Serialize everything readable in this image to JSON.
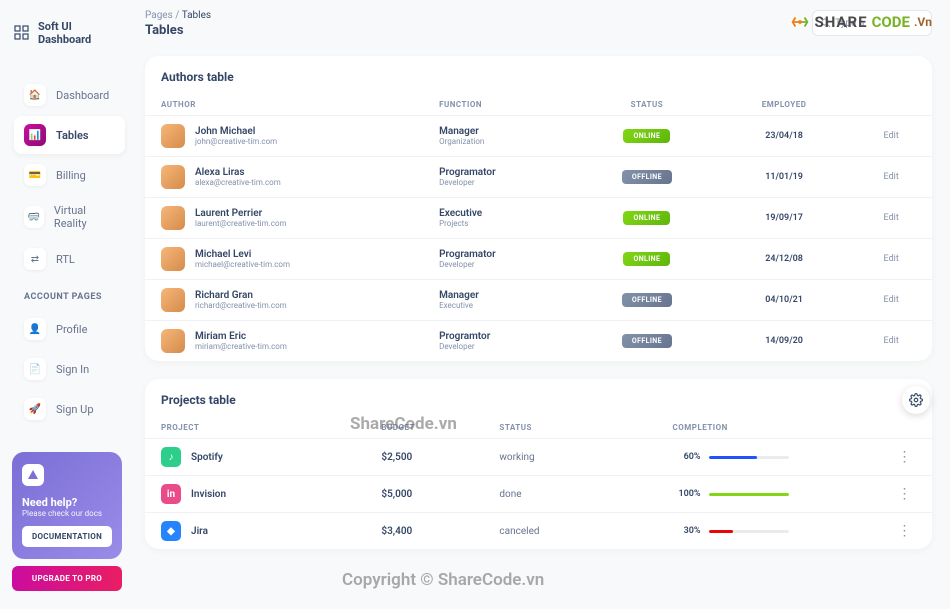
{
  "brand": "Soft UI Dashboard",
  "breadcrumb": {
    "root": "Pages",
    "current": "Tables"
  },
  "page_title": "Tables",
  "search_placeholder": "Type h",
  "sidebar": {
    "items": [
      {
        "label": "Dashboard"
      },
      {
        "label": "Tables"
      },
      {
        "label": "Billing"
      },
      {
        "label": "Virtual Reality"
      },
      {
        "label": "RTL"
      }
    ],
    "section_label": "ACCOUNT PAGES",
    "account_items": [
      {
        "label": "Profile"
      },
      {
        "label": "Sign In"
      },
      {
        "label": "Sign Up"
      }
    ]
  },
  "help": {
    "title": "Need help?",
    "sub": "Please check our docs",
    "doc_btn": "DOCUMENTATION"
  },
  "upgrade_btn": "UPGRADE TO PRO",
  "authors_card": {
    "title": "Authors table",
    "headers": [
      "AUTHOR",
      "FUNCTION",
      "STATUS",
      "EMPLOYED",
      ""
    ],
    "rows": [
      {
        "name": "John Michael",
        "email": "john@creative-tim.com",
        "title": "Manager",
        "sub": "Organization",
        "status": "ONLINE",
        "date": "23/04/18",
        "action": "Edit"
      },
      {
        "name": "Alexa Liras",
        "email": "alexa@creative-tim.com",
        "title": "Programator",
        "sub": "Developer",
        "status": "OFFLINE",
        "date": "11/01/19",
        "action": "Edit"
      },
      {
        "name": "Laurent Perrier",
        "email": "laurent@creative-tim.com",
        "title": "Executive",
        "sub": "Projects",
        "status": "ONLINE",
        "date": "19/09/17",
        "action": "Edit"
      },
      {
        "name": "Michael Levi",
        "email": "michael@creative-tim.com",
        "title": "Programator",
        "sub": "Developer",
        "status": "ONLINE",
        "date": "24/12/08",
        "action": "Edit"
      },
      {
        "name": "Richard Gran",
        "email": "richard@creative-tim.com",
        "title": "Manager",
        "sub": "Executive",
        "status": "OFFLINE",
        "date": "04/10/21",
        "action": "Edit"
      },
      {
        "name": "Miriam Eric",
        "email": "miriam@creative-tim.com",
        "title": "Programtor",
        "sub": "Developer",
        "status": "OFFLINE",
        "date": "14/09/20",
        "action": "Edit"
      }
    ]
  },
  "projects_card": {
    "title": "Projects table",
    "headers": [
      "PROJECT",
      "BUDGET",
      "STATUS",
      "COMPLETION",
      ""
    ],
    "rows": [
      {
        "name": "Spotify",
        "budget": "$2,500",
        "status": "working",
        "pct": "60%",
        "pct_val": 60,
        "color": "#2152ff",
        "icon_bg": "#2dce89",
        "icon_txt": "♪"
      },
      {
        "name": "Invision",
        "budget": "$5,000",
        "status": "done",
        "pct": "100%",
        "pct_val": 100,
        "color": "#82d616",
        "icon_bg": "#ea4c89",
        "icon_txt": "in"
      },
      {
        "name": "Jira",
        "budget": "$3,400",
        "status": "canceled",
        "pct": "30%",
        "pct_val": 30,
        "color": "#ea0606",
        "icon_bg": "#2684ff",
        "icon_txt": "◆"
      }
    ]
  },
  "watermarks": {
    "share": "SHARE",
    "code": "CODE",
    "vn": ".Vn",
    "mid": "ShareCode.vn",
    "bottom": "Copyright © ShareCode.vn"
  }
}
